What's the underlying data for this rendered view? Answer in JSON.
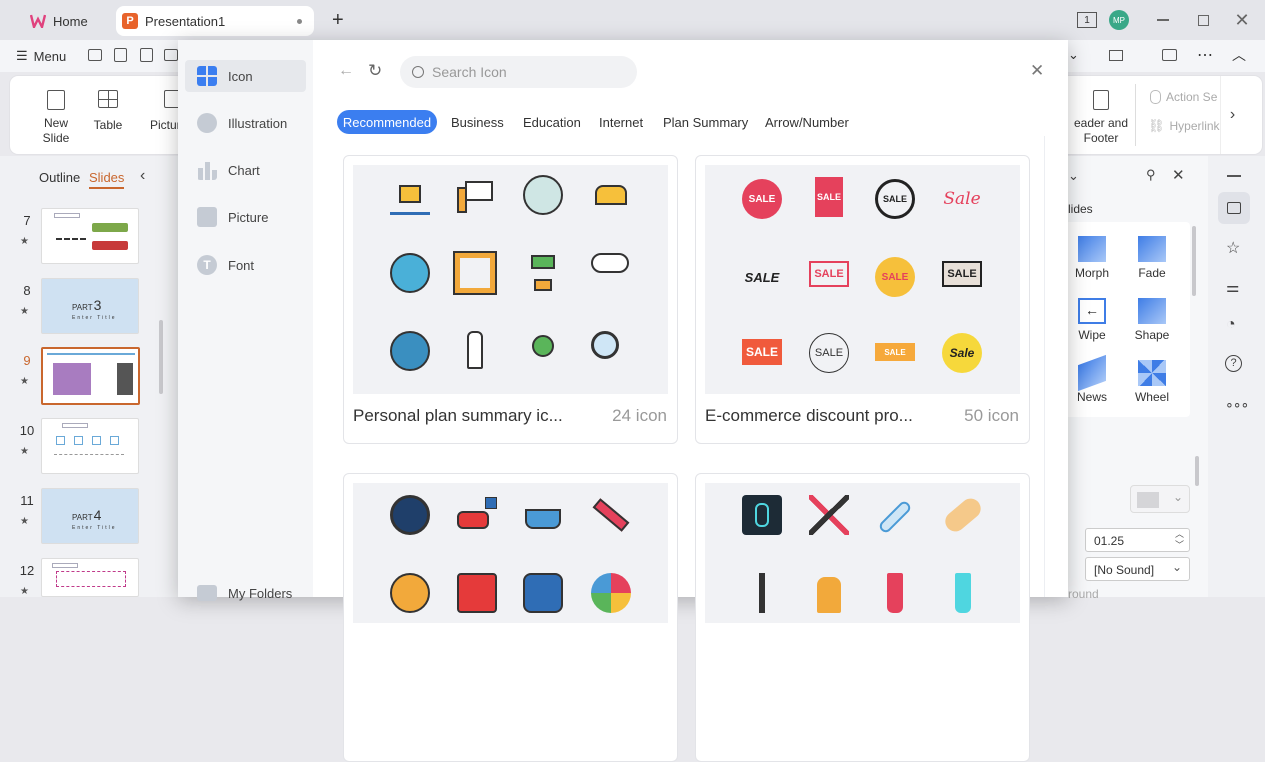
{
  "titlebar": {
    "home_tab": "Home",
    "doc_tab": "Presentation1",
    "new_tab": "+",
    "page_indicator": "1",
    "avatar_initials": "MP"
  },
  "menu": {
    "label": "Menu"
  },
  "ribbon": {
    "new_slide": "New",
    "new_slide2": "Slide",
    "table": "Table",
    "picture": "Pictur",
    "header_footer": "eader and",
    "header_footer2": "Footer",
    "action": "Action Se",
    "hyperlink": "Hyperlink"
  },
  "left_panel": {
    "outline_tab": "Outline",
    "slides_tab": "Slides",
    "slides": [
      {
        "num": "7"
      },
      {
        "num": "8",
        "part": "PART",
        "part_num": "3",
        "subtitle": "Enter Title"
      },
      {
        "num": "9"
      },
      {
        "num": "10"
      },
      {
        "num": "11",
        "part": "PART",
        "part_num": "4",
        "subtitle": "Enter Title"
      },
      {
        "num": "12"
      }
    ]
  },
  "right_panel": {
    "section_label": "lides",
    "transitions": [
      "Morph",
      "Fade",
      "Wipe",
      "Shape",
      "News",
      "Wheel"
    ],
    "duration": "01.25",
    "sound": "[No Sound]",
    "bottom_text": "round"
  },
  "dialog": {
    "nav": [
      "Icon",
      "Illustration",
      "Chart",
      "Picture",
      "Font"
    ],
    "my_folders": "My Folders",
    "search_placeholder": "Search Icon",
    "categories": [
      "Recommended",
      "Business",
      "Education",
      "Internet",
      "Plan Summary",
      "Arrow/Number"
    ],
    "cards": [
      {
        "title": "Personal plan summary ic...",
        "count": "24 icon"
      },
      {
        "title": "E-commerce discount pro...",
        "count": "50 icon"
      },
      {
        "title": "",
        "count": ""
      },
      {
        "title": "",
        "count": ""
      }
    ],
    "sale_labels": [
      "SALE",
      "SALE",
      "SALE",
      "Sale",
      "SALE",
      "SALE",
      "SALE",
      "SALE",
      "SALE",
      "SALE",
      "SALE",
      "Sale"
    ]
  },
  "colors": {
    "accent": "#3b7ef0",
    "brand_orange": "#e8632b",
    "selected_slide": "#c9672e"
  }
}
